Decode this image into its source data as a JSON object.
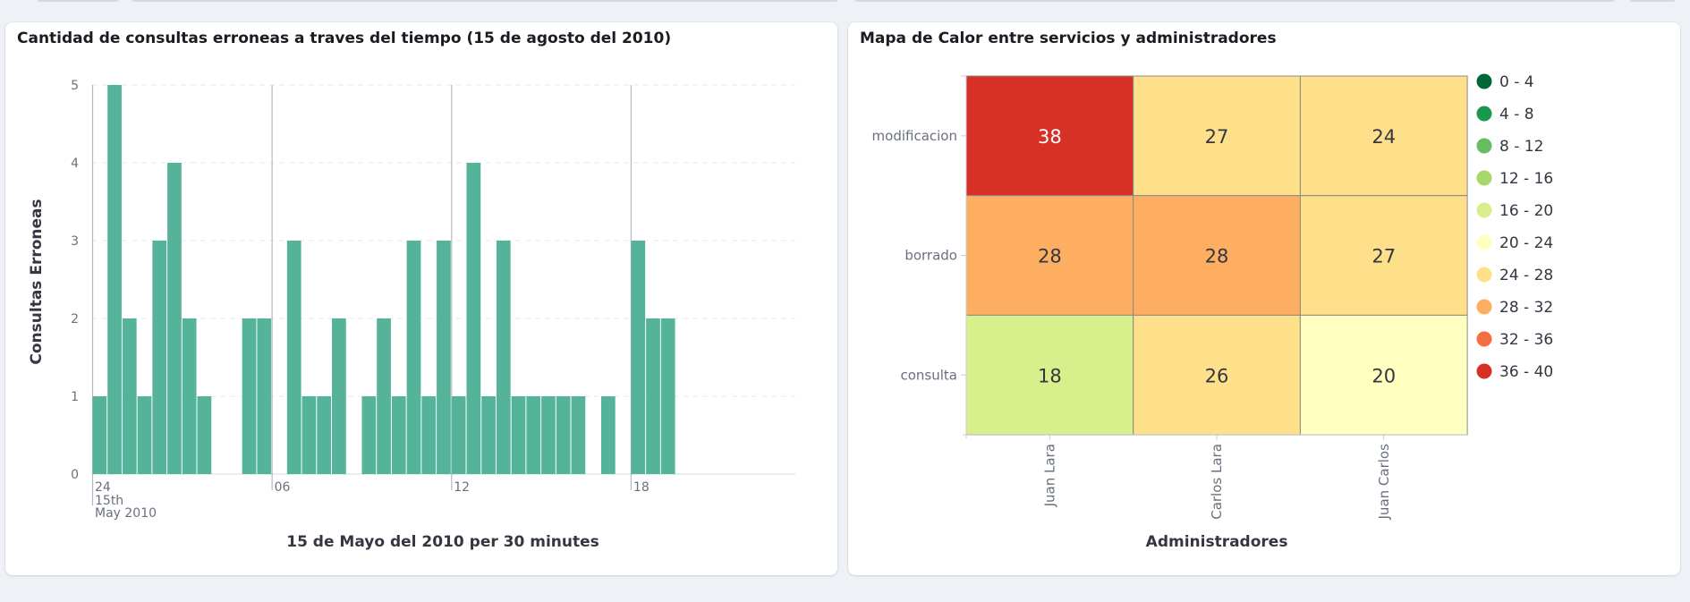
{
  "panels": [
    {
      "title": "Cantidad de consultas erroneas a traves del tiempo (15 de agosto del 2010)",
      "chart_data": {
        "type": "bar",
        "title": "Cantidad de consultas erroneas a traves del tiempo (15 de agosto del 2010)",
        "xlabel": "15 de Mayo del 2010 per 30 minutes",
        "ylabel": "Consultas Erroneas",
        "ylim": [
          0,
          5
        ],
        "yticks": [
          "0",
          "1",
          "2",
          "3",
          "4",
          "5"
        ],
        "xticks": [
          {
            "label": "24",
            "sub": [
              "15th",
              "May 2010"
            ],
            "slot": 0
          },
          {
            "label": "06",
            "slot": 12
          },
          {
            "label": "12",
            "slot": 24
          },
          {
            "label": "18",
            "slot": 36
          }
        ],
        "total_slots": 47,
        "values": [
          1,
          5,
          2,
          1,
          3,
          4,
          2,
          1,
          0,
          0,
          2,
          2,
          0,
          3,
          1,
          1,
          2,
          0,
          1,
          2,
          1,
          3,
          1,
          3,
          1,
          4,
          1,
          3,
          1,
          1,
          1,
          1,
          1,
          0,
          1,
          0,
          3,
          2,
          2,
          0,
          0,
          0,
          0,
          0,
          0,
          0,
          0
        ],
        "color": "#54b399",
        "grid": true
      }
    },
    {
      "title": "Mapa de Calor entre servicios y administradores",
      "chart_data": {
        "type": "heatmap",
        "title": "Mapa de Calor entre servicios y administradores",
        "xlabel": "Administradores",
        "ylabel": "",
        "x": [
          "Juan Lara",
          "Carlos Lara",
          "Juan Carlos"
        ],
        "y": [
          "modificacion",
          "borrado",
          "consulta"
        ],
        "values": [
          [
            38,
            27,
            24
          ],
          [
            28,
            28,
            27
          ],
          [
            18,
            26,
            20
          ]
        ],
        "legend_position": "right",
        "legend": [
          {
            "label": "0 - 4",
            "color": "#006837"
          },
          {
            "label": "4 - 8",
            "color": "#1a9850"
          },
          {
            "label": "8 - 12",
            "color": "#66bd63"
          },
          {
            "label": "12 - 16",
            "color": "#a6d96a"
          },
          {
            "label": "16 - 20",
            "color": "#d9ef8b"
          },
          {
            "label": "20 - 24",
            "color": "#ffffbf"
          },
          {
            "label": "24 - 28",
            "color": "#fee08b"
          },
          {
            "label": "28 - 32",
            "color": "#fdae61"
          },
          {
            "label": "32 - 36",
            "color": "#f46d43"
          },
          {
            "label": "36 - 40",
            "color": "#d73027"
          }
        ]
      }
    }
  ]
}
